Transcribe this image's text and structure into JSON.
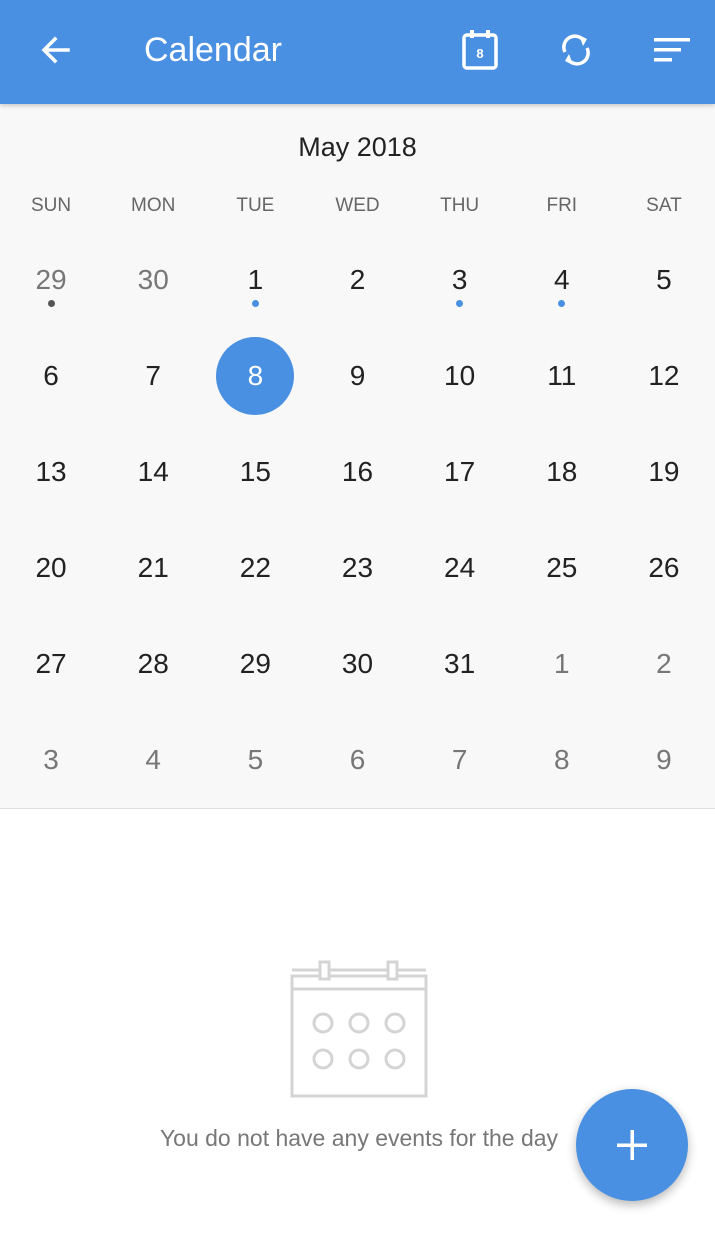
{
  "appbar": {
    "title": "Calendar",
    "back_icon": "arrow-left-icon",
    "today_icon": "calendar-today-icon",
    "today_number": "8",
    "sync_icon": "sync-icon",
    "sort_icon": "sort-icon",
    "color": "#4a90e2"
  },
  "calendar": {
    "month_label": "May 2018",
    "weekdays": [
      "SUN",
      "MON",
      "TUE",
      "WED",
      "THU",
      "FRI",
      "SAT"
    ],
    "selected_day": "8",
    "weeks": [
      [
        {
          "d": "29",
          "other": true,
          "dot": "#555555"
        },
        {
          "d": "30",
          "other": true
        },
        {
          "d": "1",
          "dot": "#4a90e2"
        },
        {
          "d": "2"
        },
        {
          "d": "3",
          "dot": "#4a90e2"
        },
        {
          "d": "4",
          "dot": "#4a90e2"
        },
        {
          "d": "5"
        }
      ],
      [
        {
          "d": "6"
        },
        {
          "d": "7"
        },
        {
          "d": "8",
          "selected": true
        },
        {
          "d": "9"
        },
        {
          "d": "10"
        },
        {
          "d": "11"
        },
        {
          "d": "12"
        }
      ],
      [
        {
          "d": "13"
        },
        {
          "d": "14"
        },
        {
          "d": "15"
        },
        {
          "d": "16"
        },
        {
          "d": "17"
        },
        {
          "d": "18"
        },
        {
          "d": "19"
        }
      ],
      [
        {
          "d": "20"
        },
        {
          "d": "21"
        },
        {
          "d": "22"
        },
        {
          "d": "23"
        },
        {
          "d": "24"
        },
        {
          "d": "25"
        },
        {
          "d": "26"
        }
      ],
      [
        {
          "d": "27"
        },
        {
          "d": "28"
        },
        {
          "d": "29"
        },
        {
          "d": "30"
        },
        {
          "d": "31"
        },
        {
          "d": "1",
          "other": true
        },
        {
          "d": "2",
          "other": true
        }
      ],
      [
        {
          "d": "3",
          "other": true
        },
        {
          "d": "4",
          "other": true
        },
        {
          "d": "5",
          "other": true
        },
        {
          "d": "6",
          "other": true
        },
        {
          "d": "7",
          "other": true
        },
        {
          "d": "8",
          "other": true
        },
        {
          "d": "9",
          "other": true
        }
      ]
    ]
  },
  "empty_state": {
    "icon": "empty-calendar-icon",
    "message": "You do not have any events for the day"
  },
  "fab": {
    "icon": "plus-icon",
    "color": "#4a90e2"
  }
}
